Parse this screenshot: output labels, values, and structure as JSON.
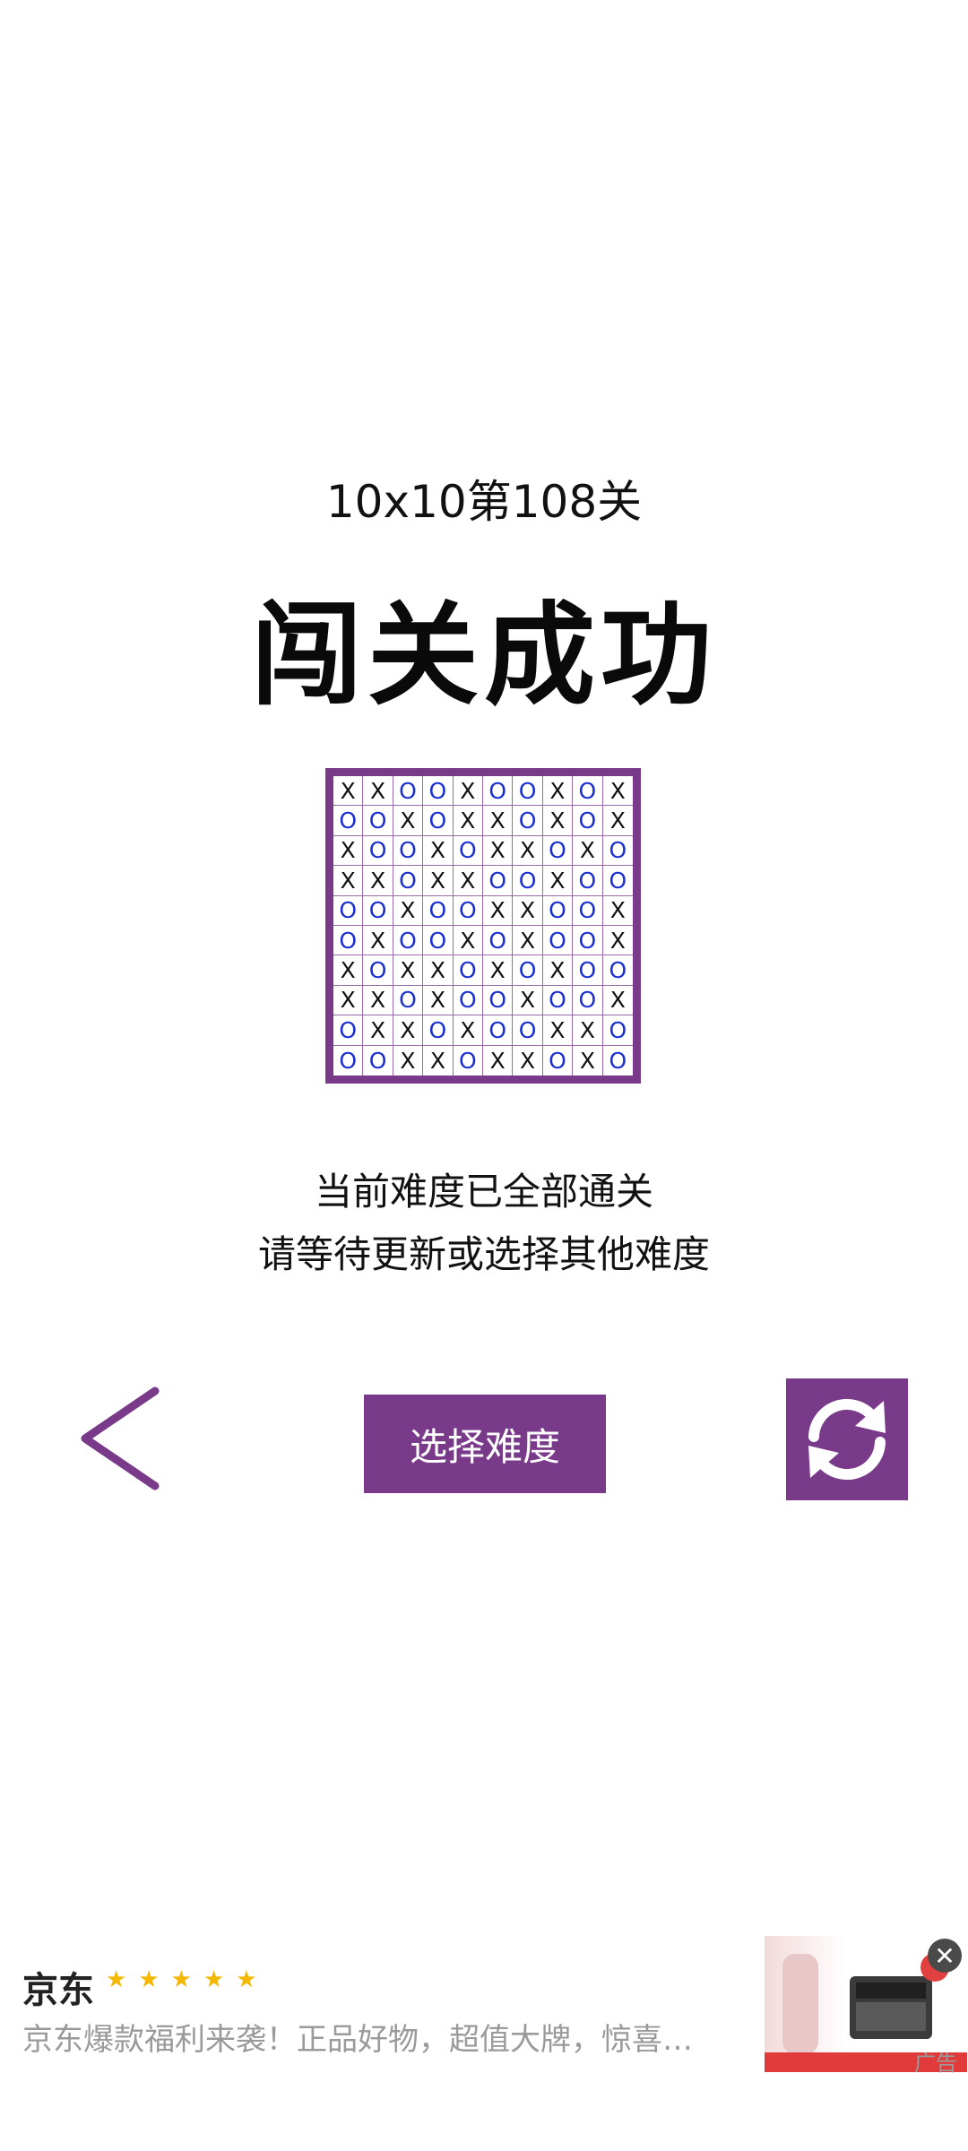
{
  "level_label": "10x10第108关",
  "result_title": "闯关成功",
  "board": {
    "rows": [
      "XXOOXOOXOX",
      "OOXOXXOXOX",
      "XOOXOXXOXO",
      "XXOXXOOXOO",
      "OOXOOXXOOX",
      "OXOOXOXOOX",
      "XOXXOXOXOO",
      "XXOXOOXOOX",
      "OXXOXOOXXO",
      "OOXXOXXOXO"
    ],
    "colors": {
      "x": "#111111",
      "o": "#1a2fd0",
      "border": "#7a3a8a"
    }
  },
  "message": {
    "line1": "当前难度已全部通关",
    "line2": "请等待更新或选择其他难度"
  },
  "controls": {
    "back_icon": "chevron-left-icon",
    "choose_label": "选择难度",
    "refresh_icon": "refresh-icon",
    "accent": "#7a3a8a"
  },
  "ad": {
    "title": "京东",
    "rating": 5,
    "text": "京东爆款福利来袭！正品好物，超值大牌，惊喜…",
    "mark": "广告"
  }
}
